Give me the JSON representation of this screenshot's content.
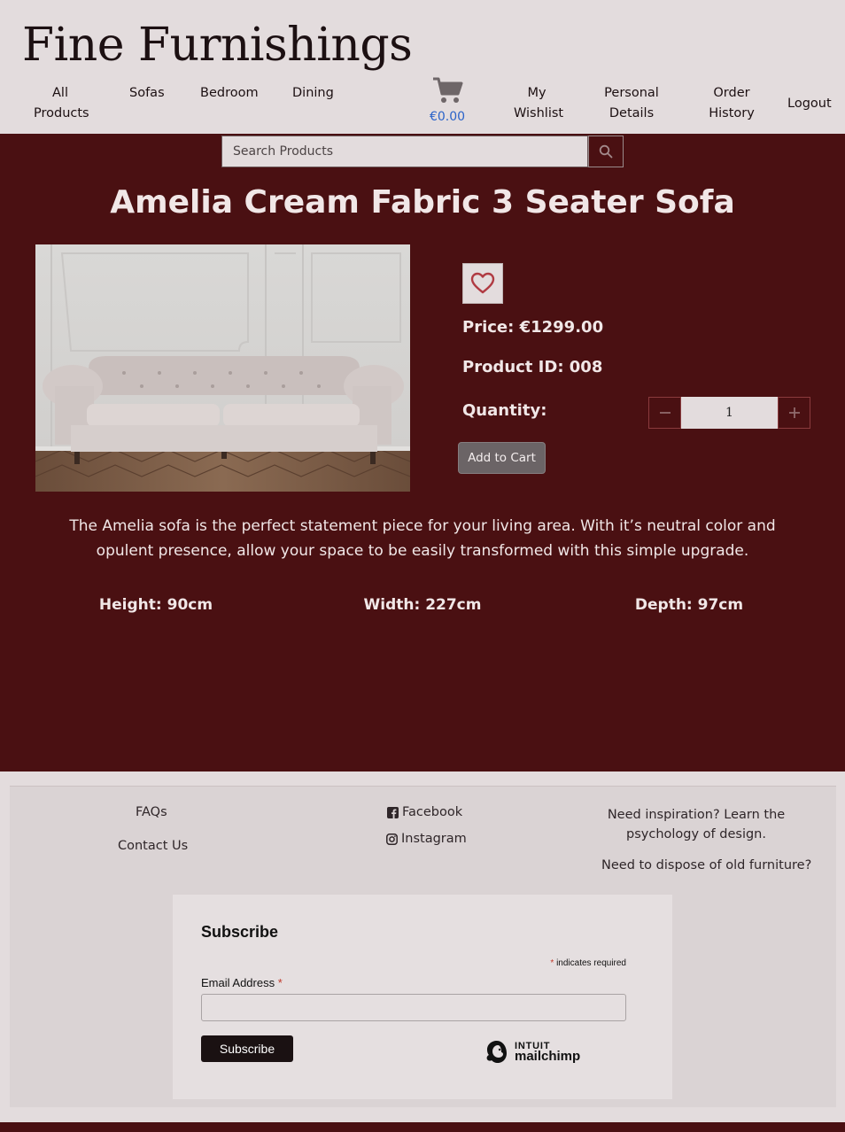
{
  "brand": {
    "name": "Fine Furnishings"
  },
  "nav": {
    "all_products": "All\nProducts",
    "sofas": "Sofas",
    "bedroom": "Bedroom",
    "dining": "Dining",
    "cart_total": "€0.00",
    "wishlist": "My\nWishlist",
    "personal_details": "Personal\nDetails",
    "order_history": "Order\nHistory",
    "logout": "Logout"
  },
  "search": {
    "placeholder": "Search Products",
    "icon": "search-icon"
  },
  "product": {
    "title": "Amelia Cream Fabric 3 Seater Sofa",
    "price": "Price: €1299.00",
    "product_id": "Product ID: 008",
    "quantity_label": "Quantity:",
    "quantity_value": "1",
    "add_to_cart": "Add to Cart",
    "description": "The Amelia sofa is the perfect statement piece for your living area. With it’s neutral color and opulent presence, allow your space to be easily transformed with this simple upgrade.",
    "height": "Height: 90cm",
    "width": "Width: 227cm",
    "depth": "Depth: 97cm"
  },
  "footer": {
    "faqs": "FAQs",
    "contact": "Contact Us",
    "facebook": "Facebook",
    "instagram": "Instagram",
    "inspiration": "Need inspiration? Learn the psychology of design.",
    "dispose": "Need to dispose of old furniture?"
  },
  "subscribe": {
    "title": "Subscribe",
    "required_note": "indicates required",
    "asterisk": "*",
    "email_label": "Email Address",
    "button": "Subscribe",
    "logo_top": "INTUIT",
    "logo_bottom": "mailchimp"
  },
  "colors": {
    "brand_dark": "#4a1012",
    "header_bg": "#e3dcdd",
    "link_blue": "#2a63c9"
  }
}
